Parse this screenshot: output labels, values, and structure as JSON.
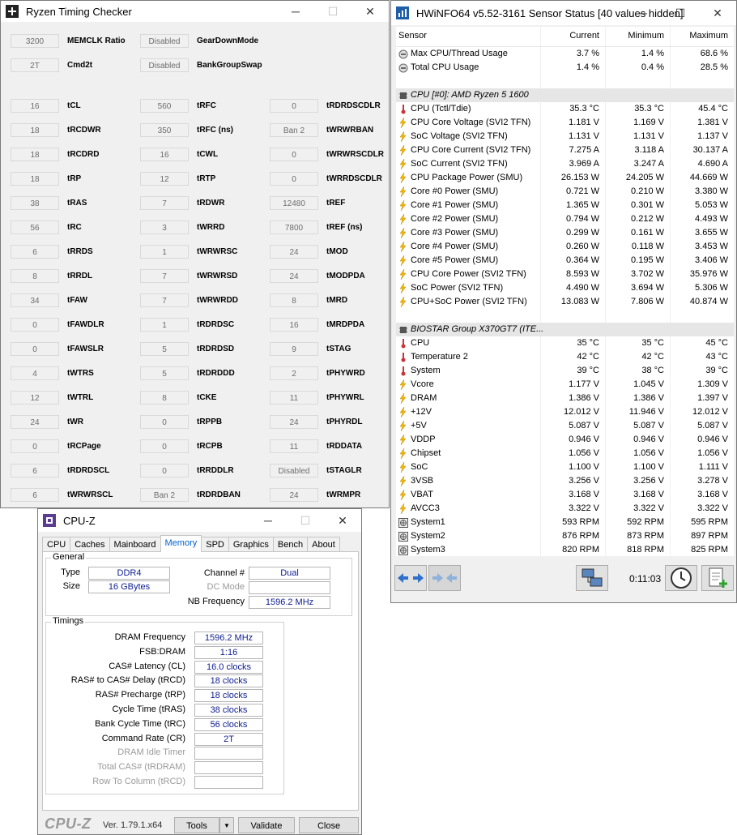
{
  "rtc": {
    "title": "Ryzen Timing Checker",
    "controls": {
      "minimize": "─",
      "maximize": "☐",
      "close": "✕"
    },
    "top": [
      {
        "value": "3200",
        "label": "MEMCLK Ratio"
      },
      {
        "value": "Disabled",
        "label": "GearDownMode"
      },
      {
        "value": "2T",
        "label": "Cmd2t"
      },
      {
        "value": "Disabled",
        "label": "BankGroupSwap"
      }
    ],
    "col1": [
      {
        "value": "16",
        "label": "tCL"
      },
      {
        "value": "18",
        "label": "tRCDWR"
      },
      {
        "value": "18",
        "label": "tRCDRD"
      },
      {
        "value": "18",
        "label": "tRP"
      },
      {
        "value": "38",
        "label": "tRAS"
      },
      {
        "value": "56",
        "label": "tRC"
      },
      {
        "value": "6",
        "label": "tRRDS"
      },
      {
        "value": "8",
        "label": "tRRDL"
      },
      {
        "value": "34",
        "label": "tFAW"
      },
      {
        "value": "0",
        "label": "tFAWDLR"
      },
      {
        "value": "0",
        "label": "tFAWSLR"
      },
      {
        "value": "4",
        "label": "tWTRS"
      },
      {
        "value": "12",
        "label": "tWTRL"
      },
      {
        "value": "24",
        "label": "tWR"
      },
      {
        "value": "0",
        "label": "tRCPage"
      },
      {
        "value": "6",
        "label": "tRDRDSCL"
      },
      {
        "value": "6",
        "label": "tWRWRSCL"
      }
    ],
    "col2": [
      {
        "value": "560",
        "label": "tRFC"
      },
      {
        "value": "350",
        "label": "tRFC (ns)"
      },
      {
        "value": "16",
        "label": "tCWL"
      },
      {
        "value": "12",
        "label": "tRTP"
      },
      {
        "value": "7",
        "label": "tRDWR"
      },
      {
        "value": "3",
        "label": "tWRRD"
      },
      {
        "value": "1",
        "label": "tWRWRSC"
      },
      {
        "value": "7",
        "label": "tWRWRSD"
      },
      {
        "value": "7",
        "label": "tWRWRDD"
      },
      {
        "value": "1",
        "label": "tRDRDSC"
      },
      {
        "value": "5",
        "label": "tRDRDSD"
      },
      {
        "value": "5",
        "label": "tRDRDDD"
      },
      {
        "value": "8",
        "label": "tCKE"
      },
      {
        "value": "0",
        "label": "tRPPB"
      },
      {
        "value": "0",
        "label": "tRCPB"
      },
      {
        "value": "0",
        "label": "tRRDDLR"
      },
      {
        "value": "Ban 2",
        "label": "tRDRDBAN"
      }
    ],
    "col3": [
      {
        "value": "0",
        "label": "tRDRDSCDLR"
      },
      {
        "value": "Ban 2",
        "label": "tWRWRBAN"
      },
      {
        "value": "0",
        "label": "tWRWRSCDLR"
      },
      {
        "value": "0",
        "label": "tWRRDSCDLR"
      },
      {
        "value": "12480",
        "label": "tREF"
      },
      {
        "value": "7800",
        "label": "tREF (ns)"
      },
      {
        "value": "24",
        "label": "tMOD"
      },
      {
        "value": "24",
        "label": "tMODPDA"
      },
      {
        "value": "8",
        "label": "tMRD"
      },
      {
        "value": "16",
        "label": "tMRDPDA"
      },
      {
        "value": "9",
        "label": "tSTAG"
      },
      {
        "value": "2",
        "label": "tPHYWRD"
      },
      {
        "value": "11",
        "label": "tPHYWRL"
      },
      {
        "value": "24",
        "label": "tPHYRDL"
      },
      {
        "value": "11",
        "label": "tRDDATA"
      },
      {
        "value": "Disabled",
        "label": "tSTAGLR"
      },
      {
        "value": "24",
        "label": "tWRMPR"
      }
    ]
  },
  "hwinfo": {
    "title": "HWiNFO64 v5.52-3161 Sensor Status [40 values hidden]",
    "controls": {
      "minimize": "─",
      "maximize": "☐",
      "close": "✕"
    },
    "headers": {
      "sensor": "Sensor",
      "current": "Current",
      "minimum": "Minimum",
      "maximum": "Maximum"
    },
    "rows": [
      {
        "type": "row",
        "icon": "usage",
        "name": "Max CPU/Thread Usage",
        "cur": "3.7 %",
        "min": "1.4 %",
        "max": "68.6 %"
      },
      {
        "type": "row",
        "icon": "usage",
        "name": "Total CPU Usage",
        "cur": "1.4 %",
        "min": "0.4 %",
        "max": "28.5 %"
      },
      {
        "type": "blank"
      },
      {
        "type": "group",
        "name": "CPU [#0]: AMD Ryzen 5 1600"
      },
      {
        "type": "row",
        "icon": "temp",
        "name": "CPU (Tctl/Tdie)",
        "cur": "35.3 °C",
        "min": "35.3 °C",
        "max": "45.4 °C"
      },
      {
        "type": "row",
        "icon": "volt",
        "name": "CPU Core Voltage (SVI2 TFN)",
        "cur": "1.181 V",
        "min": "1.169 V",
        "max": "1.381 V"
      },
      {
        "type": "row",
        "icon": "volt",
        "name": "SoC Voltage (SVI2 TFN)",
        "cur": "1.131 V",
        "min": "1.131 V",
        "max": "1.137 V"
      },
      {
        "type": "row",
        "icon": "volt",
        "name": "CPU Core Current (SVI2 TFN)",
        "cur": "7.275 A",
        "min": "3.118 A",
        "max": "30.137 A"
      },
      {
        "type": "row",
        "icon": "volt",
        "name": "SoC Current (SVI2 TFN)",
        "cur": "3.969 A",
        "min": "3.247 A",
        "max": "4.690 A"
      },
      {
        "type": "row",
        "icon": "volt",
        "name": "CPU Package Power (SMU)",
        "cur": "26.153 W",
        "min": "24.205 W",
        "max": "44.669 W"
      },
      {
        "type": "row",
        "icon": "volt",
        "name": "Core #0 Power (SMU)",
        "cur": "0.721 W",
        "min": "0.210 W",
        "max": "3.380 W"
      },
      {
        "type": "row",
        "icon": "volt",
        "name": "Core #1 Power (SMU)",
        "cur": "1.365 W",
        "min": "0.301 W",
        "max": "5.053 W"
      },
      {
        "type": "row",
        "icon": "volt",
        "name": "Core #2 Power (SMU)",
        "cur": "0.794 W",
        "min": "0.212 W",
        "max": "4.493 W"
      },
      {
        "type": "row",
        "icon": "volt",
        "name": "Core #3 Power (SMU)",
        "cur": "0.299 W",
        "min": "0.161 W",
        "max": "3.655 W"
      },
      {
        "type": "row",
        "icon": "volt",
        "name": "Core #4 Power (SMU)",
        "cur": "0.260 W",
        "min": "0.118 W",
        "max": "3.453 W"
      },
      {
        "type": "row",
        "icon": "volt",
        "name": "Core #5 Power (SMU)",
        "cur": "0.364 W",
        "min": "0.195 W",
        "max": "3.406 W"
      },
      {
        "type": "row",
        "icon": "volt",
        "name": "CPU Core Power (SVI2 TFN)",
        "cur": "8.593 W",
        "min": "3.702 W",
        "max": "35.976 W"
      },
      {
        "type": "row",
        "icon": "volt",
        "name": "SoC Power (SVI2 TFN)",
        "cur": "4.490 W",
        "min": "3.694 W",
        "max": "5.306 W"
      },
      {
        "type": "row",
        "icon": "volt",
        "name": "CPU+SoC Power (SVI2 TFN)",
        "cur": "13.083 W",
        "min": "7.806 W",
        "max": "40.874 W"
      },
      {
        "type": "blank"
      },
      {
        "type": "group",
        "name": "BIOSTAR Group X370GT7 (ITE..."
      },
      {
        "type": "row",
        "icon": "temp",
        "name": "CPU",
        "cur": "35 °C",
        "min": "35 °C",
        "max": "45 °C"
      },
      {
        "type": "row",
        "icon": "temp",
        "name": "Temperature 2",
        "cur": "42 °C",
        "min": "42 °C",
        "max": "43 °C"
      },
      {
        "type": "row",
        "icon": "temp",
        "name": "System",
        "cur": "39 °C",
        "min": "38 °C",
        "max": "39 °C"
      },
      {
        "type": "row",
        "icon": "volt",
        "name": "Vcore",
        "cur": "1.177 V",
        "min": "1.045 V",
        "max": "1.309 V"
      },
      {
        "type": "row",
        "icon": "volt",
        "name": "DRAM",
        "cur": "1.386 V",
        "min": "1.386 V",
        "max": "1.397 V"
      },
      {
        "type": "row",
        "icon": "volt",
        "name": "+12V",
        "cur": "12.012 V",
        "min": "11.946 V",
        "max": "12.012 V"
      },
      {
        "type": "row",
        "icon": "volt",
        "name": "+5V",
        "cur": "5.087 V",
        "min": "5.087 V",
        "max": "5.087 V"
      },
      {
        "type": "row",
        "icon": "volt",
        "name": "VDDP",
        "cur": "0.946 V",
        "min": "0.946 V",
        "max": "0.946 V"
      },
      {
        "type": "row",
        "icon": "volt",
        "name": "Chipset",
        "cur": "1.056 V",
        "min": "1.056 V",
        "max": "1.056 V"
      },
      {
        "type": "row",
        "icon": "volt",
        "name": "SoC",
        "cur": "1.100 V",
        "min": "1.100 V",
        "max": "1.111 V"
      },
      {
        "type": "row",
        "icon": "volt",
        "name": "3VSB",
        "cur": "3.256 V",
        "min": "3.256 V",
        "max": "3.278 V"
      },
      {
        "type": "row",
        "icon": "volt",
        "name": "VBAT",
        "cur": "3.168 V",
        "min": "3.168 V",
        "max": "3.168 V"
      },
      {
        "type": "row",
        "icon": "volt",
        "name": "AVCC3",
        "cur": "3.322 V",
        "min": "3.322 V",
        "max": "3.322 V"
      },
      {
        "type": "row",
        "icon": "fan",
        "name": "System1",
        "cur": "593 RPM",
        "min": "592 RPM",
        "max": "595 RPM"
      },
      {
        "type": "row",
        "icon": "fan",
        "name": "System2",
        "cur": "876 RPM",
        "min": "873 RPM",
        "max": "897 RPM"
      },
      {
        "type": "row",
        "icon": "fan",
        "name": "System3",
        "cur": "820 RPM",
        "min": "818 RPM",
        "max": "825 RPM"
      }
    ],
    "timer": "0:11:03"
  },
  "cpuz": {
    "title": "CPU-Z",
    "controls": {
      "minimize": "─",
      "maximize": "☐",
      "close": "✕"
    },
    "tabs": [
      "CPU",
      "Caches",
      "Mainboard",
      "Memory",
      "SPD",
      "Graphics",
      "Bench",
      "About"
    ],
    "active_tab": "Memory",
    "general": {
      "legend": "General",
      "type_label": "Type",
      "type_value": "DDR4",
      "size_label": "Size",
      "size_value": "16 GBytes",
      "channel_label": "Channel #",
      "channel_value": "Dual",
      "dc_label": "DC Mode",
      "dc_value": "",
      "nb_label": "NB Frequency",
      "nb_value": "1596.2 MHz"
    },
    "timings": {
      "legend": "Timings",
      "rows": [
        {
          "label": "DRAM Frequency",
          "value": "1596.2 MHz",
          "dim": false
        },
        {
          "label": "FSB:DRAM",
          "value": "1:16",
          "dim": false
        },
        {
          "label": "CAS# Latency (CL)",
          "value": "16.0 clocks",
          "dim": false
        },
        {
          "label": "RAS# to CAS# Delay (tRCD)",
          "value": "18 clocks",
          "dim": false
        },
        {
          "label": "RAS# Precharge (tRP)",
          "value": "18 clocks",
          "dim": false
        },
        {
          "label": "Cycle Time (tRAS)",
          "value": "38 clocks",
          "dim": false
        },
        {
          "label": "Bank Cycle Time (tRC)",
          "value": "56 clocks",
          "dim": false
        },
        {
          "label": "Command Rate (CR)",
          "value": "2T",
          "dim": false
        },
        {
          "label": "DRAM Idle Timer",
          "value": "",
          "dim": true
        },
        {
          "label": "Total CAS# (tRDRAM)",
          "value": "",
          "dim": true
        },
        {
          "label": "Row To Column (tRCD)",
          "value": "",
          "dim": true
        }
      ]
    },
    "footer": {
      "logo": "CPU-Z",
      "version": "Ver. 1.79.1.x64",
      "tools": "Tools",
      "tools_arrow": "▼",
      "validate": "Validate",
      "close": "Close"
    }
  }
}
